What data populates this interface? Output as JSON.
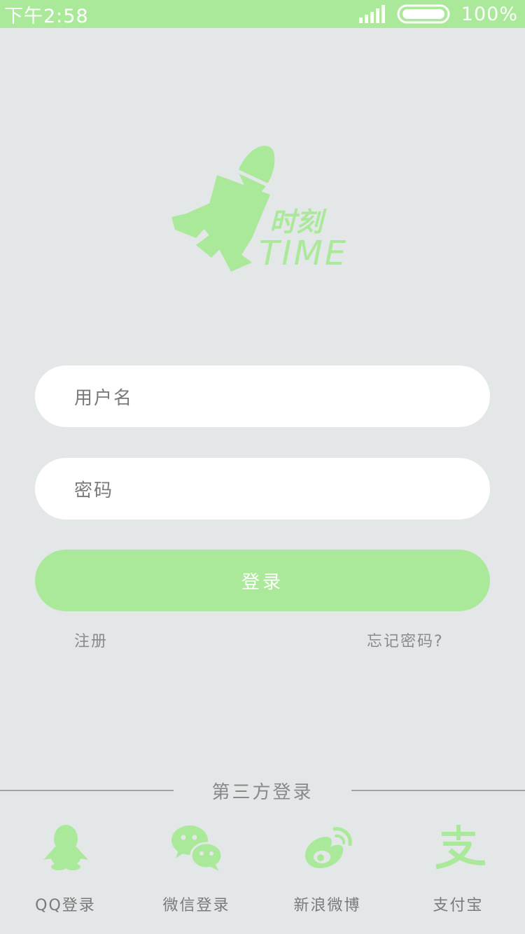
{
  "status_bar": {
    "time": "下午2:58",
    "battery": "100%",
    "icons": [
      "signal-icon",
      "battery-icon"
    ]
  },
  "logo": {
    "name": "时刻",
    "subtitle": "TIME"
  },
  "form": {
    "username_placeholder": "用户名",
    "password_placeholder": "密码",
    "login_label": "登录",
    "register_label": "注册",
    "forgot_label": "忘记密码?"
  },
  "third_party": {
    "title": "第三方登录",
    "items": [
      {
        "label": "QQ登录",
        "icon": "qq-icon"
      },
      {
        "label": "微信登录",
        "icon": "wechat-icon"
      },
      {
        "label": "新浪微博",
        "icon": "weibo-icon"
      },
      {
        "label": "支付宝",
        "icon": "alipay-icon"
      }
    ]
  },
  "colors": {
    "accent": "#abe99a",
    "background": "#e3e7e8",
    "field": "#ffffff",
    "text_gray": "#7a7a7a"
  }
}
